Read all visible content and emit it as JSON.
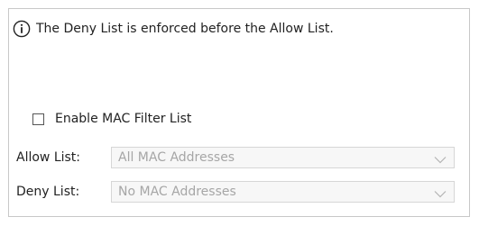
{
  "notice": {
    "icon": "info-icon",
    "text": "The Deny List is enforced before the Allow List."
  },
  "mac_filter": {
    "checkbox_label": "Enable MAC Filter List",
    "checked": false
  },
  "allow_list": {
    "label": "Allow List:",
    "value": "All MAC Addresses",
    "disabled": true
  },
  "deny_list": {
    "label": "Deny List:",
    "value": "No MAC Addresses",
    "disabled": true
  },
  "colors": {
    "border": "#c8c8c8",
    "disabled_text": "#a6a6a6",
    "disabled_bg": "#f7f7f7"
  }
}
